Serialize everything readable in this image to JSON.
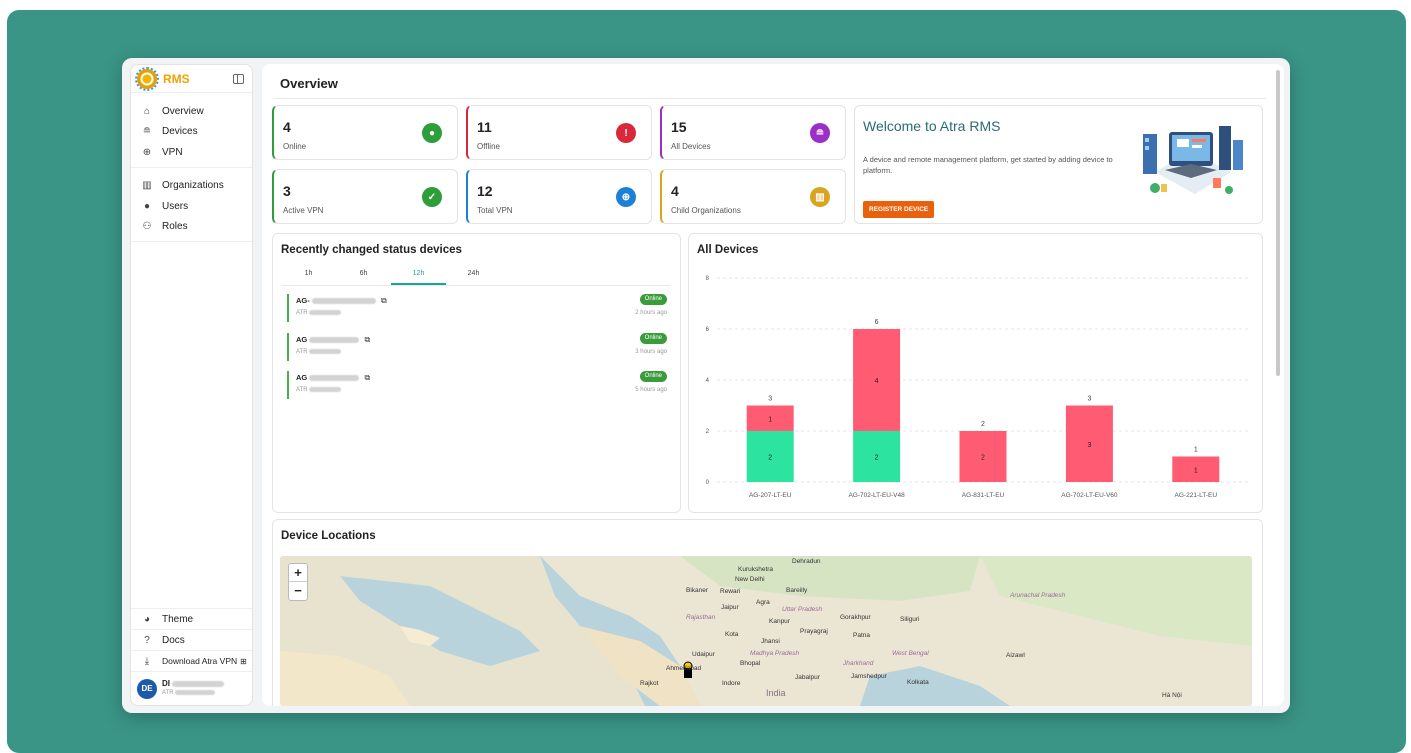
{
  "brand": {
    "name": "RMS"
  },
  "sidebar": {
    "items": [
      {
        "label": "Overview"
      },
      {
        "label": "Devices"
      },
      {
        "label": "VPN"
      },
      {
        "label": "Organizations"
      },
      {
        "label": "Users"
      },
      {
        "label": "Roles"
      }
    ],
    "bottom": [
      {
        "label": "Theme"
      },
      {
        "label": "Docs"
      },
      {
        "label": "Download Atra VPN"
      }
    ],
    "user": {
      "avatar": "DE",
      "name": "DI",
      "org": "ATR"
    }
  },
  "page": {
    "title": "Overview"
  },
  "stats": [
    {
      "value": "4",
      "label": "Online",
      "color": "#2e9e3a"
    },
    {
      "value": "11",
      "label": "Offline",
      "color": "#d8283a"
    },
    {
      "value": "15",
      "label": "All Devices",
      "color": "#9b2fc7"
    },
    {
      "value": "3",
      "label": "Active VPN",
      "color": "#2e9e3a"
    },
    {
      "value": "12",
      "label": "Total VPN",
      "color": "#1e7fd8"
    },
    {
      "value": "4",
      "label": "Child Organizations",
      "color": "#d9a41e"
    }
  ],
  "welcome": {
    "title": "Welcome to Atra RMS",
    "description": "A device and remote management platform, get started by adding device to platform.",
    "button": "REGISTER DEVICE"
  },
  "recent": {
    "title": "Recently changed status devices",
    "tabs": [
      "1h",
      "6h",
      "12h",
      "24h"
    ],
    "active_tab": "12h",
    "devices": [
      {
        "name": "AG-",
        "org": "ATR",
        "status": "Online",
        "time": "2 hours ago"
      },
      {
        "name": "AG",
        "org": "ATR",
        "status": "Online",
        "time": "3 hours ago"
      },
      {
        "name": "AG",
        "org": "ATR",
        "status": "Online",
        "time": "5 hours ago"
      }
    ]
  },
  "chart_data": {
    "type": "bar",
    "title": "All Devices",
    "categories": [
      "AG-207-LT-EU",
      "AG-702-LT-EU-V48",
      "AG-831-LT-EU",
      "AG-702-LT-EU-V60",
      "AG-221-LT-EU"
    ],
    "series": [
      {
        "values": [
          2,
          2,
          0,
          0,
          0
        ],
        "color": "#2de3a0"
      },
      {
        "values": [
          1,
          4,
          2,
          3,
          1
        ],
        "color": "#ff5c73"
      }
    ],
    "totals": [
      3,
      6,
      2,
      3,
      1
    ],
    "stacked": true,
    "ylim": [
      0,
      8
    ],
    "yticks": [
      0,
      2,
      4,
      6,
      8
    ],
    "grid": true
  },
  "map": {
    "title": "Device Locations",
    "zoom_in": "+",
    "zoom_out": "−",
    "labels": [
      "Dehradun",
      "Kurukshetra",
      "New Delhi",
      "Bareilly",
      "Bikaner",
      "Rewari",
      "Jaipur",
      "Agra",
      "Kanpur",
      "Gorakhpur",
      "Siliguri",
      "Prayagraj",
      "Patna",
      "Kota",
      "Jhansi",
      "Udaipur",
      "Ahmedabad",
      "Bhopal",
      "Jabalpur",
      "Jamshedpur",
      "Kolkata",
      "Rajkot",
      "Indore",
      "India",
      "Aizawl",
      "Rajasthan",
      "Uttar Pradesh",
      "Madhya Pradesh",
      "Jharkhand",
      "West Bengal",
      "Arunachal Pradesh",
      "Hà Nội"
    ]
  },
  "colors": {
    "accent": "#1aa39b",
    "background": "#3a9587"
  }
}
